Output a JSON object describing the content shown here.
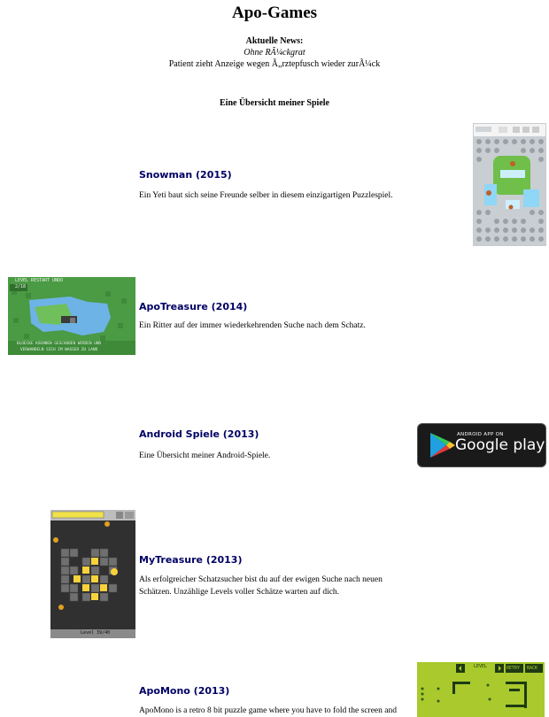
{
  "page": {
    "title": "Apo-Games",
    "news_label": "Aktuelle News:",
    "news_items": [
      "Ohne RÃ¼ckgrat",
      "Patient zieht Anzeige wegen Ã„rztepfusch wieder zurÃ¼ck"
    ],
    "overview_heading": "Eine Übersicht meiner Spiele"
  },
  "games": [
    {
      "title": "Snowman (2015)",
      "description": "Ein Yeti baut sich seine Freunde selber in diesem einzigartigen Puzzlespiel.",
      "thumbnail": "snowman-screenshot"
    },
    {
      "title": "ApoTreasure (2014)",
      "description": "Ein Ritter auf der immer wiederkehrenden Suche nach dem Schatz.",
      "thumbnail": "apotreasure-screenshot",
      "thumbnail_text": {
        "top": "LEVEL   RESTART  UNDO",
        "level": "2/18",
        "bottom1": "BLOECKE KOENNEN GESCHOBEN WERDEN UND",
        "bottom2": "VERWANDELN SICH IM WASSER ZU LAND"
      }
    },
    {
      "title": "Android Spiele (2013)",
      "description": "Eine Übersicht meiner Android-Spiele.",
      "thumbnail": "google-play-badge",
      "badge_small": "ANDROID APP ON",
      "badge_big": "Google play"
    },
    {
      "title": "MyTreasure (2013)",
      "description": "Als erfolgreicher Schatzsucher bist du auf der ewigen Suche nach neuen Schätzen. Unzählige Levels voller Schätze warten auf dich.",
      "thumbnail": "mytreasure-screenshot",
      "thumbnail_text": {
        "footer": "Level 39/40"
      }
    },
    {
      "title": "ApoMono (2013)",
      "description": "ApoMono is a retro 8 bit puzzle game where you have to fold the screen and",
      "thumbnail": "apomono-screenshot",
      "thumbnail_text": {
        "level": "LEVEL",
        "retry": "RETRY",
        "back": "BACK"
      }
    }
  ],
  "colors": {
    "link": "#000066",
    "text": "#000000",
    "background": "#ffffff"
  }
}
